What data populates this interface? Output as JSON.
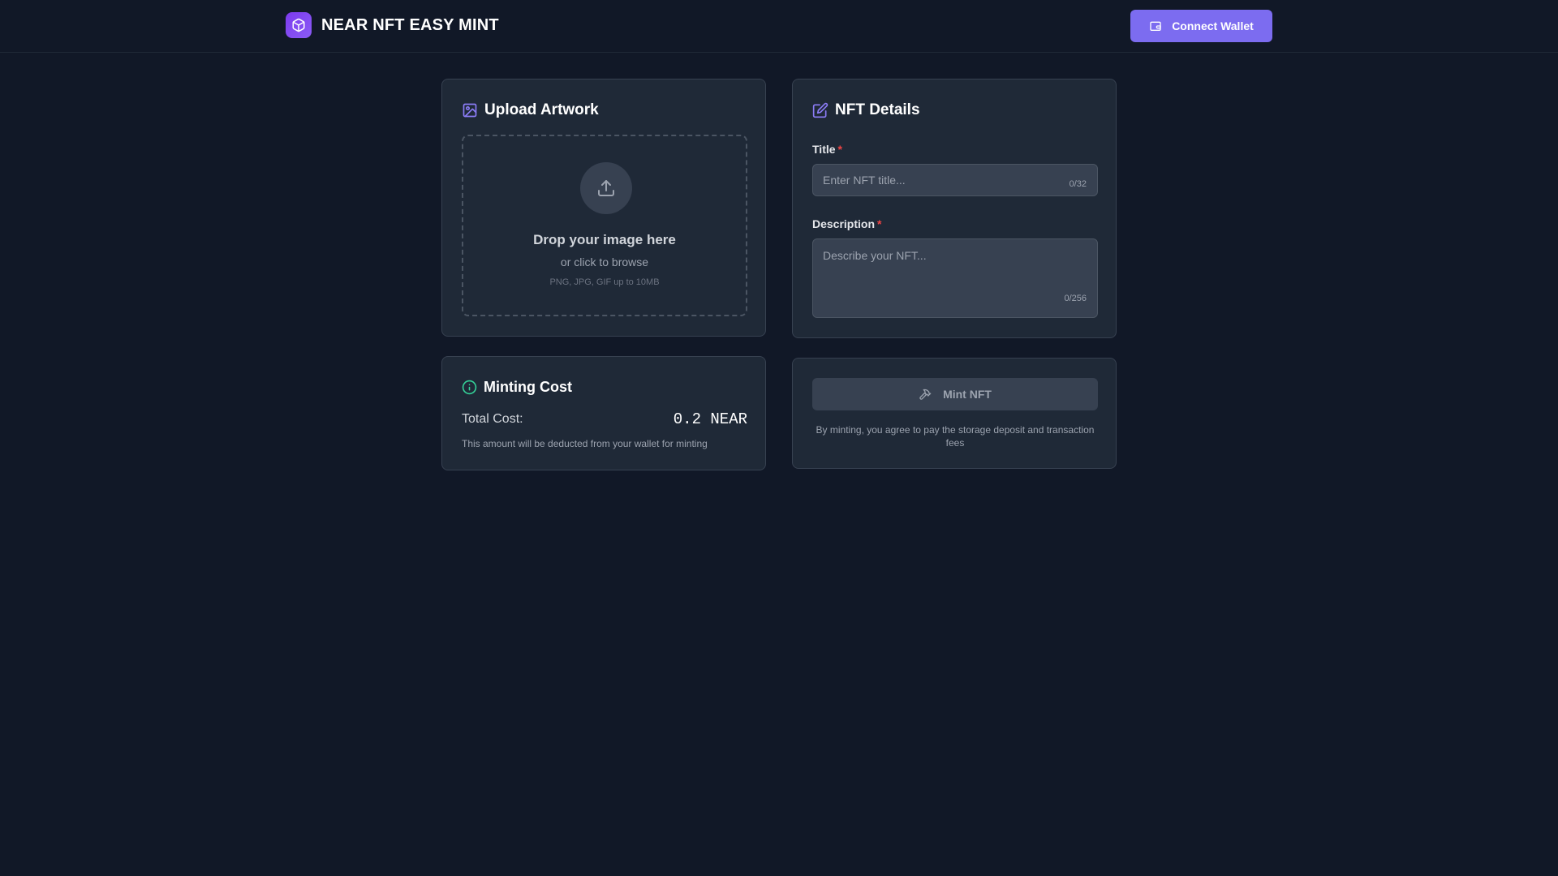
{
  "header": {
    "title": "NEAR NFT EASY MINT",
    "logo_icon": "cube-icon",
    "connect_label": "Connect Wallet",
    "connect_icon": "wallet-icon",
    "accent_color": "#7c6cf0"
  },
  "upload": {
    "title": "Upload Artwork",
    "title_icon": "image-icon",
    "drop_main": "Drop your image here",
    "drop_sub": "or click to browse",
    "drop_hint": "PNG, JPG, GIF up to 10MB",
    "upload_icon": "upload-icon"
  },
  "details": {
    "title": "NFT Details",
    "title_icon": "edit-icon",
    "title_field": {
      "label": "Title",
      "required_mark": "*",
      "placeholder": "Enter NFT title...",
      "value": "",
      "counter": "0/32"
    },
    "description_field": {
      "label": "Description",
      "required_mark": "*",
      "placeholder": "Describe your NFT...",
      "value": "",
      "counter": "0/256"
    }
  },
  "cost": {
    "title": "Minting Cost",
    "title_icon": "info-icon",
    "label": "Total Cost:",
    "value": "0.2 NEAR",
    "note": "This amount will be deducted from your wallet for minting"
  },
  "mint": {
    "button_label": "Mint NFT",
    "button_icon": "hammer-icon",
    "note": "By minting, you agree to pay the storage deposit and transaction fees"
  }
}
